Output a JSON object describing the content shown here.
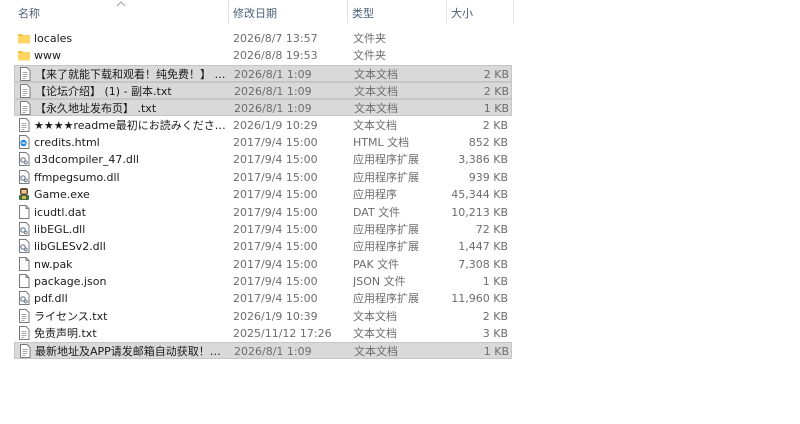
{
  "columns": {
    "name": "名称",
    "date": "修改日期",
    "type": "类型",
    "size": "大小"
  },
  "files": [
    {
      "icon": "folder-icon",
      "name": "locales",
      "date": "2026/8/7 13:57",
      "type": "文件夹",
      "size": "",
      "selected": false
    },
    {
      "icon": "folder-icon",
      "name": "www",
      "date": "2026/8/8 19:53",
      "type": "文件夹",
      "size": "",
      "selected": false
    },
    {
      "icon": "text-file-icon",
      "name": "【来了就能下载和观看！纯免费！】 - 副...",
      "date": "2026/8/1 1:09",
      "type": "文本文档",
      "size": "2 KB",
      "selected": true
    },
    {
      "icon": "text-file-icon",
      "name": "【论坛介绍】 (1) - 副本.txt",
      "date": "2026/8/1 1:09",
      "type": "文本文档",
      "size": "2 KB",
      "selected": true
    },
    {
      "icon": "text-file-icon",
      "name": "【永久地址发布页】 .txt",
      "date": "2026/8/1 1:09",
      "type": "文本文档",
      "size": "1 KB",
      "selected": true
    },
    {
      "icon": "text-file-icon",
      "name": "★★★★readme最初にお読みください！...",
      "date": "2026/1/9 10:29",
      "type": "文本文档",
      "size": "2 KB",
      "selected": false
    },
    {
      "icon": "html-file-icon",
      "name": "credits.html",
      "date": "2017/9/4 15:00",
      "type": "HTML 文档",
      "size": "852 KB",
      "selected": false
    },
    {
      "icon": "dll-file-icon",
      "name": "d3dcompiler_47.dll",
      "date": "2017/9/4 15:00",
      "type": "应用程序扩展",
      "size": "3,386 KB",
      "selected": false
    },
    {
      "icon": "dll-file-icon",
      "name": "ffmpegsumo.dll",
      "date": "2017/9/4 15:00",
      "type": "应用程序扩展",
      "size": "939 KB",
      "selected": false
    },
    {
      "icon": "game-exe-icon",
      "name": "Game.exe",
      "date": "2017/9/4 15:00",
      "type": "应用程序",
      "size": "45,344 KB",
      "selected": false
    },
    {
      "icon": "blank-file-icon",
      "name": "icudtl.dat",
      "date": "2017/9/4 15:00",
      "type": "DAT 文件",
      "size": "10,213 KB",
      "selected": false
    },
    {
      "icon": "dll-file-icon",
      "name": "libEGL.dll",
      "date": "2017/9/4 15:00",
      "type": "应用程序扩展",
      "size": "72 KB",
      "selected": false
    },
    {
      "icon": "dll-file-icon",
      "name": "libGLESv2.dll",
      "date": "2017/9/4 15:00",
      "type": "应用程序扩展",
      "size": "1,447 KB",
      "selected": false
    },
    {
      "icon": "blank-file-icon",
      "name": "nw.pak",
      "date": "2017/9/4 15:00",
      "type": "PAK 文件",
      "size": "7,308 KB",
      "selected": false
    },
    {
      "icon": "blank-file-icon",
      "name": "package.json",
      "date": "2017/9/4 15:00",
      "type": "JSON 文件",
      "size": "1 KB",
      "selected": false
    },
    {
      "icon": "dll-file-icon",
      "name": "pdf.dll",
      "date": "2017/9/4 15:00",
      "type": "应用程序扩展",
      "size": "11,960 KB",
      "selected": false
    },
    {
      "icon": "text-file-icon",
      "name": "ライセンス.txt",
      "date": "2026/1/9 10:39",
      "type": "文本文档",
      "size": "2 KB",
      "selected": false
    },
    {
      "icon": "text-file-icon",
      "name": "免责声明.txt",
      "date": "2025/11/12 17:26",
      "type": "文本文档",
      "size": "3 KB",
      "selected": false
    },
    {
      "icon": "text-file-icon",
      "name": "最新地址及APP请发邮箱自动获取！！！...",
      "date": "2026/8/1 1:09",
      "type": "文本文档",
      "size": "1 KB",
      "selected": true
    }
  ],
  "colors": {
    "header_text": "#4c607a",
    "selected_bg": "#d9d9d9",
    "folder": "#f5c242"
  }
}
